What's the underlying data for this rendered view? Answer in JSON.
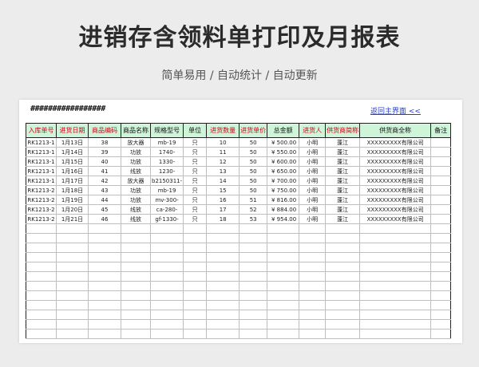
{
  "header": {
    "title": "进销存含领料单打印及月报表",
    "subtitle": "简单易用 / 自动统计 / 自动更新"
  },
  "sheet": {
    "hash_text": "#################",
    "back_link": "返回主界面 <<",
    "columns": [
      {
        "label": "入库单号",
        "color": "red"
      },
      {
        "label": "进货日期",
        "color": "red"
      },
      {
        "label": "商品编码",
        "color": "red"
      },
      {
        "label": "商品名称",
        "color": "black"
      },
      {
        "label": "规格型号",
        "color": "black"
      },
      {
        "label": "单位",
        "color": "black"
      },
      {
        "label": "进货数量",
        "color": "red"
      },
      {
        "label": "进货单价",
        "color": "red"
      },
      {
        "label": "总金额",
        "color": "black"
      },
      {
        "label": "进货人",
        "color": "red"
      },
      {
        "label": "供货商简称",
        "color": "red"
      },
      {
        "label": "供货商全称",
        "color": "black"
      },
      {
        "label": "备注",
        "color": "black"
      }
    ],
    "rows": [
      [
        "RK1213-1",
        "1月13日",
        "38",
        "放大器",
        "mb-19",
        "只",
        "10",
        "50",
        "¥ 500.00",
        "小明",
        "蓬江",
        "XXXXXXXXX有限公司",
        ""
      ],
      [
        "RK1213-1",
        "1月14日",
        "39",
        "功放",
        "1740-",
        "只",
        "11",
        "50",
        "¥ 550.00",
        "小明",
        "蓬江",
        "XXXXXXXXX有限公司",
        ""
      ],
      [
        "RK1213-1",
        "1月15日",
        "40",
        "功放",
        "1330-",
        "只",
        "12",
        "50",
        "¥ 600.00",
        "小明",
        "蓬江",
        "XXXXXXXXX有限公司",
        ""
      ],
      [
        "RK1213-1",
        "1月16日",
        "41",
        "线放",
        "1230-",
        "只",
        "13",
        "50",
        "¥ 650.00",
        "小明",
        "蓬江",
        "XXXXXXXXX有限公司",
        ""
      ],
      [
        "RK1213-1",
        "1月17日",
        "42",
        "放大器",
        "b2150311-",
        "只",
        "14",
        "50",
        "¥ 700.00",
        "小明",
        "蓬江",
        "XXXXXXXXX有限公司",
        ""
      ],
      [
        "RK1213-2",
        "1月18日",
        "43",
        "功放",
        "mb-19",
        "只",
        "15",
        "50",
        "¥ 750.00",
        "小明",
        "蓬江",
        "XXXXXXXXX有限公司",
        ""
      ],
      [
        "RK1213-2",
        "1月19日",
        "44",
        "功放",
        "mv-300-",
        "只",
        "16",
        "51",
        "¥ 816.00",
        "小明",
        "蓬江",
        "XXXXXXXXX有限公司",
        ""
      ],
      [
        "RK1213-2",
        "1月20日",
        "45",
        "线放",
        "ca-280-",
        "只",
        "17",
        "52",
        "¥ 884.00",
        "小明",
        "蓬江",
        "XXXXXXXXX有限公司",
        ""
      ],
      [
        "RK1213-2",
        "1月21日",
        "46",
        "线放",
        "gf-1330-",
        "只",
        "18",
        "53",
        "¥ 954.00",
        "小明",
        "蓬江",
        "XXXXXXXXX有限公司",
        ""
      ]
    ],
    "empty_rows": 12,
    "colors": {
      "header_bg": "#cff5d8",
      "header_red": "#d0021b",
      "link": "#2440c8"
    }
  }
}
